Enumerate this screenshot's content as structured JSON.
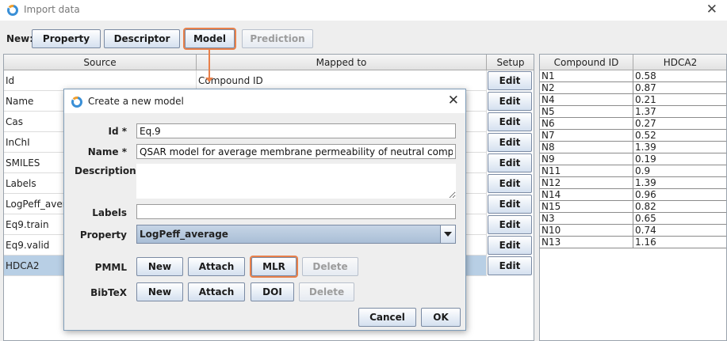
{
  "window": {
    "title": "Import data"
  },
  "toolbar": {
    "new_label": "New:",
    "buttons": [
      "Property",
      "Descriptor",
      "Model",
      "Prediction"
    ]
  },
  "main_table": {
    "headers": [
      "Source",
      "Mapped to",
      "Setup"
    ],
    "rows": [
      {
        "source": "Id",
        "mapped": "Compound ID",
        "setup": "Edit"
      },
      {
        "source": "Name",
        "mapped": "",
        "setup": "Edit"
      },
      {
        "source": "Cas",
        "mapped": "",
        "setup": "Edit"
      },
      {
        "source": "InChI",
        "mapped": "",
        "setup": "Edit"
      },
      {
        "source": "SMILES",
        "mapped": "",
        "setup": "Edit"
      },
      {
        "source": "Labels",
        "mapped": "",
        "setup": "Edit"
      },
      {
        "source": "LogPeff_avera",
        "mapped": "",
        "setup": "Edit"
      },
      {
        "source": "Eq9.train",
        "mapped": "",
        "setup": "Edit"
      },
      {
        "source": "Eq9.valid",
        "mapped": "",
        "setup": "Edit"
      },
      {
        "source": "HDCA2",
        "mapped": "",
        "setup": "Edit"
      }
    ]
  },
  "side_table": {
    "headers": [
      "Compound ID",
      "HDCA2"
    ],
    "rows": [
      [
        "N1",
        "0.58"
      ],
      [
        "N2",
        "0.87"
      ],
      [
        "N4",
        "0.21"
      ],
      [
        "N5",
        "1.37"
      ],
      [
        "N6",
        "0.27"
      ],
      [
        "N7",
        "0.52"
      ],
      [
        "N8",
        "1.39"
      ],
      [
        "N9",
        "0.19"
      ],
      [
        "N11",
        "0.9"
      ],
      [
        "N12",
        "1.39"
      ],
      [
        "N14",
        "0.96"
      ],
      [
        "N15",
        "0.82"
      ],
      [
        "N3",
        "0.65"
      ],
      [
        "N10",
        "0.74"
      ],
      [
        "N13",
        "1.16"
      ]
    ]
  },
  "dialog": {
    "title": "Create a new model",
    "id_label": "Id *",
    "id_value": "Eq.9",
    "name_label": "Name *",
    "name_value": "QSAR model for average membrane permeability of neutral compounds",
    "description_label": "Description",
    "labels_label": "Labels",
    "labels_value": "",
    "property_label": "Property",
    "property_value": "LogPeff_average",
    "pmml_label": "PMML",
    "pmml_buttons": [
      "New",
      "Attach",
      "MLR",
      "Delete"
    ],
    "bibtex_label": "BibTeX",
    "bibtex_buttons": [
      "New",
      "Attach",
      "DOI",
      "Delete"
    ],
    "cancel_label": "Cancel",
    "ok_label": "OK"
  },
  "colors": {
    "highlight": "#e8804a",
    "selected_row": "#b8cfe5"
  },
  "icons": {
    "app": "app-ring-icon",
    "close": "close-icon",
    "dropdown": "chevron-down-icon"
  }
}
